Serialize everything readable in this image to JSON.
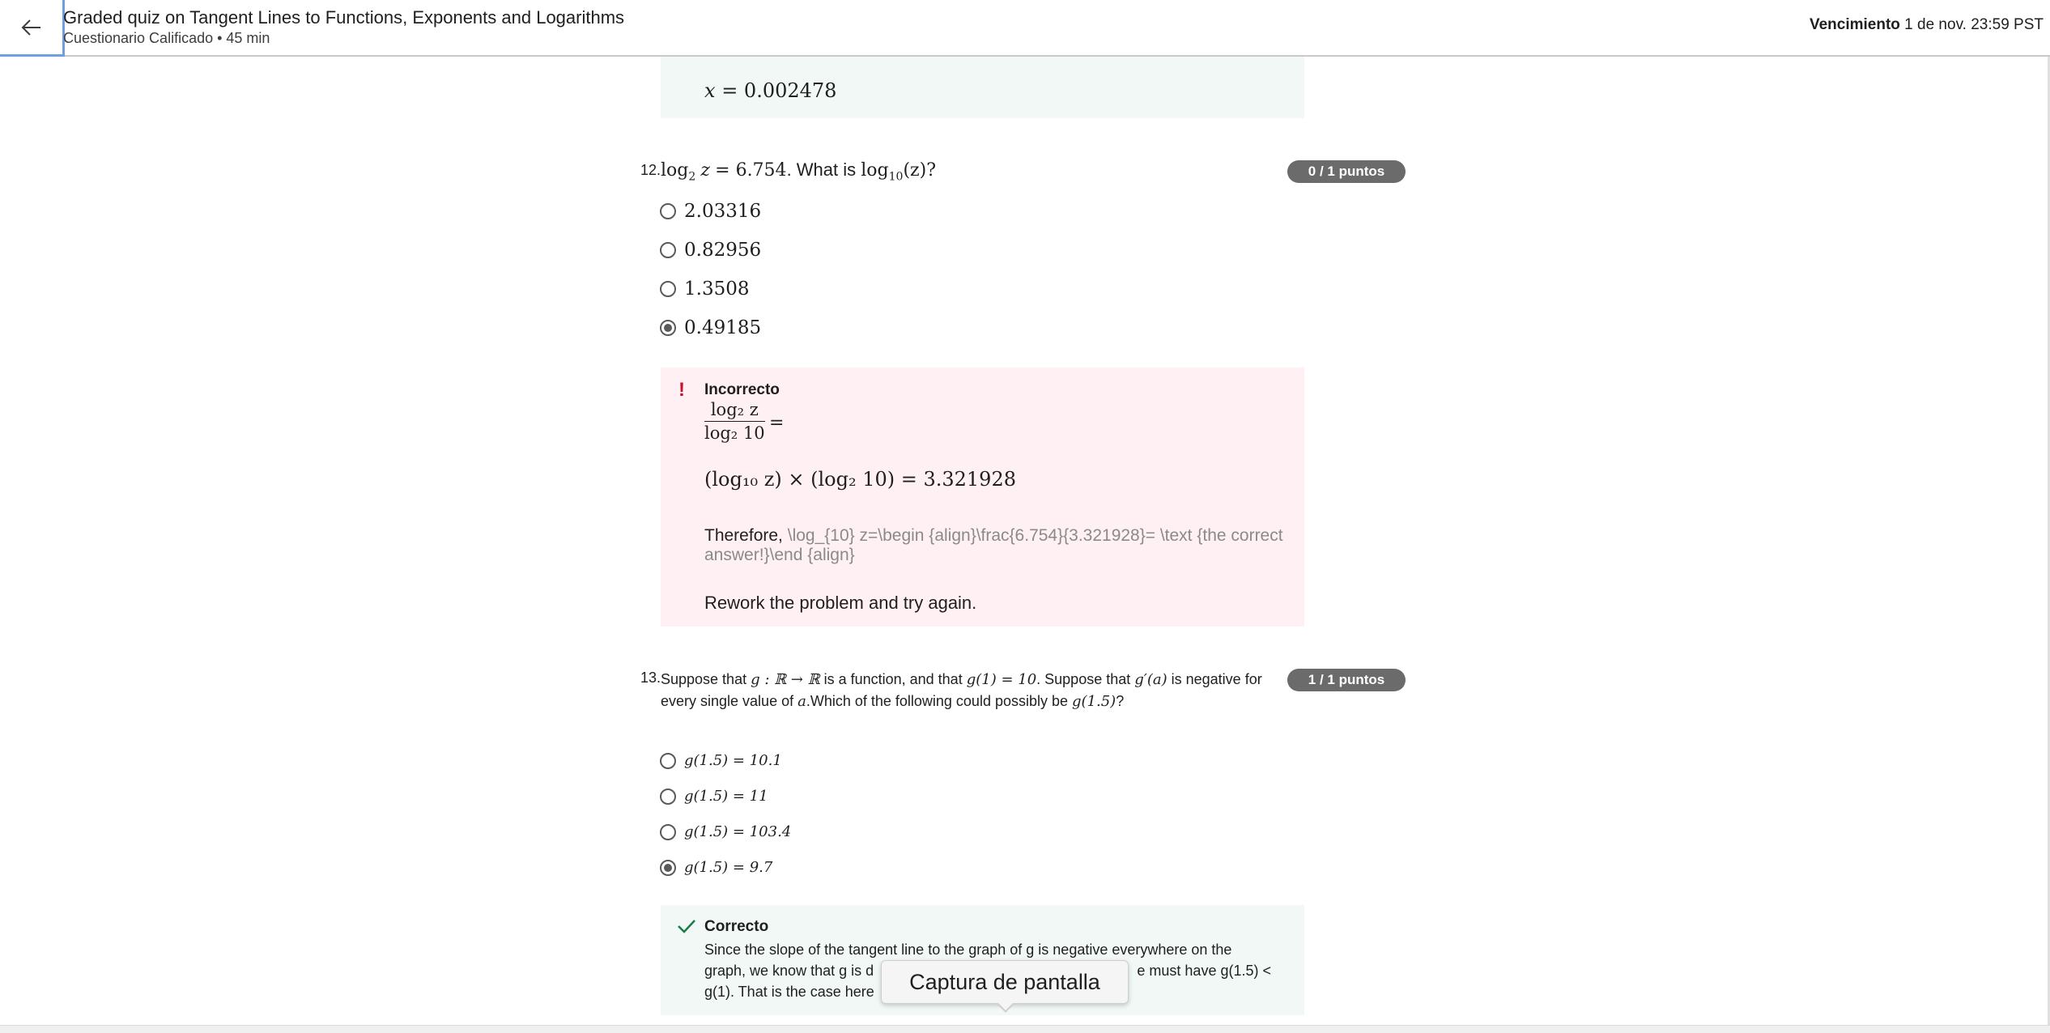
{
  "header": {
    "title": "Graded quiz on Tangent Lines to Functions, Exponents and Logarithms",
    "subtitle": "Cuestionario Calificado • 45 min",
    "due_label": "Vencimiento",
    "due_value": "1 de nov. 23:59 PST",
    "back_icon": "arrow-left-icon"
  },
  "previous": {
    "answer_var": "x",
    "answer_value": "= 0.002478"
  },
  "q12": {
    "number": "12.",
    "lhs_log": "log",
    "lhs_base": "2",
    "lhs_var": "z",
    "lhs_value": "= 6.754",
    "prompt": ". What is ",
    "rhs_log": "log",
    "rhs_base": "10",
    "rhs_arg": "(z)?",
    "points": "0 / 1 puntos",
    "options": [
      "2.03316",
      "0.82956",
      "1.3508",
      "0.49185"
    ],
    "selected_index": 3,
    "feedback": {
      "status": "Incorrecto",
      "frac_num": "log₂ z",
      "frac_den": "log₂ 10",
      "frac_eq": "=",
      "equation": "(log₁₀ z) × (log₂ 10) = 3.321928",
      "therefore_label": "Therefore,",
      "therefore_raw": "\\log_{10} z=\\begin {align}\\frac{6.754}{3.321928}= \\text {the correct answer!}\\end {align}",
      "rework": "Rework the problem and try again.",
      "icon": "exclamation-icon"
    }
  },
  "q13": {
    "number": "13.",
    "text_line1_a": "Suppose that ",
    "text_line1_math1": "g : ℝ → ℝ",
    "text_line1_b": " is a function, and that ",
    "text_line1_math2": "g(1) = 10",
    "text_line1_c": ". Suppose that ",
    "text_line1_math3": "g′(a)",
    "text_line1_d": " is negative for",
    "text_line2_a": "every single value of ",
    "text_line2_math1": "a",
    "text_line2_b": ".Which of the following could possibly be ",
    "text_line2_math2": "g(1.5)",
    "text_line2_c": "?",
    "points": "1 / 1 puntos",
    "options": [
      "g(1.5) = 10.1",
      "g(1.5) = 11",
      "g(1.5) = 103.4",
      "g(1.5) = 9.7"
    ],
    "selected_index": 3,
    "feedback": {
      "status": "Correcto",
      "line1": "Since the slope of the tangent line to the graph of g is negative everywhere on the",
      "line2": "graph, we know that g is d",
      "line2_end": "e must have g(1.5) <",
      "line3": "g(1). That is the case here",
      "icon": "checkmark-icon"
    }
  },
  "tooltip": {
    "text": "Captura de pantalla"
  },
  "colors": {
    "correct_bg": "#f1f8f5",
    "incorrect_bg": "#fff1f3",
    "badge_bg": "#6b6b6b",
    "error_red": "#c8102e",
    "check_green": "#1b7a4a"
  }
}
